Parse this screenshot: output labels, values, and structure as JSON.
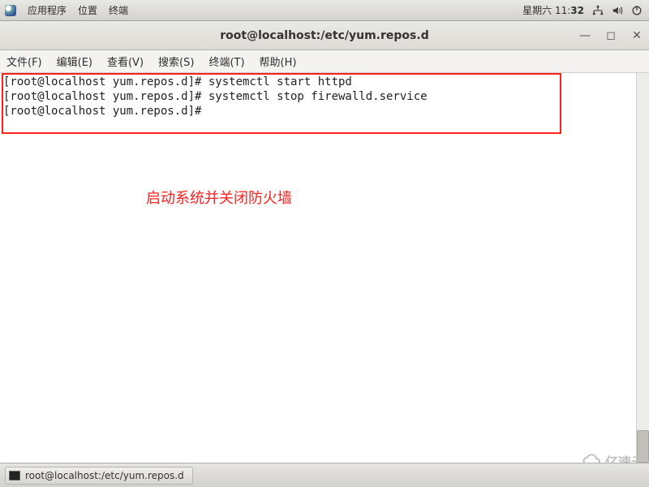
{
  "panel": {
    "menu_apps": "应用程序",
    "menu_places": "位置",
    "menu_terminal": "终端",
    "day": "星期六",
    "hour": "11",
    "minute": "32"
  },
  "window": {
    "title": "root@localhost:/etc/yum.repos.d"
  },
  "menubar": {
    "file": "文件(F)",
    "edit": "编辑(E)",
    "view": "查看(V)",
    "search": "搜索(S)",
    "terminal": "终端(T)",
    "help": "帮助(H)"
  },
  "terminal": {
    "line1": "[root@localhost yum.repos.d]# systemctl start httpd",
    "line2": "[root@localhost yum.repos.d]# systemctl stop firewalld.service",
    "line3": "[root@localhost yum.repos.d]# "
  },
  "annotation": "启动系统并关闭防火墙",
  "taskbar": {
    "item1": "root@localhost:/etc/yum.repos.d"
  },
  "watermark": "亿速云"
}
